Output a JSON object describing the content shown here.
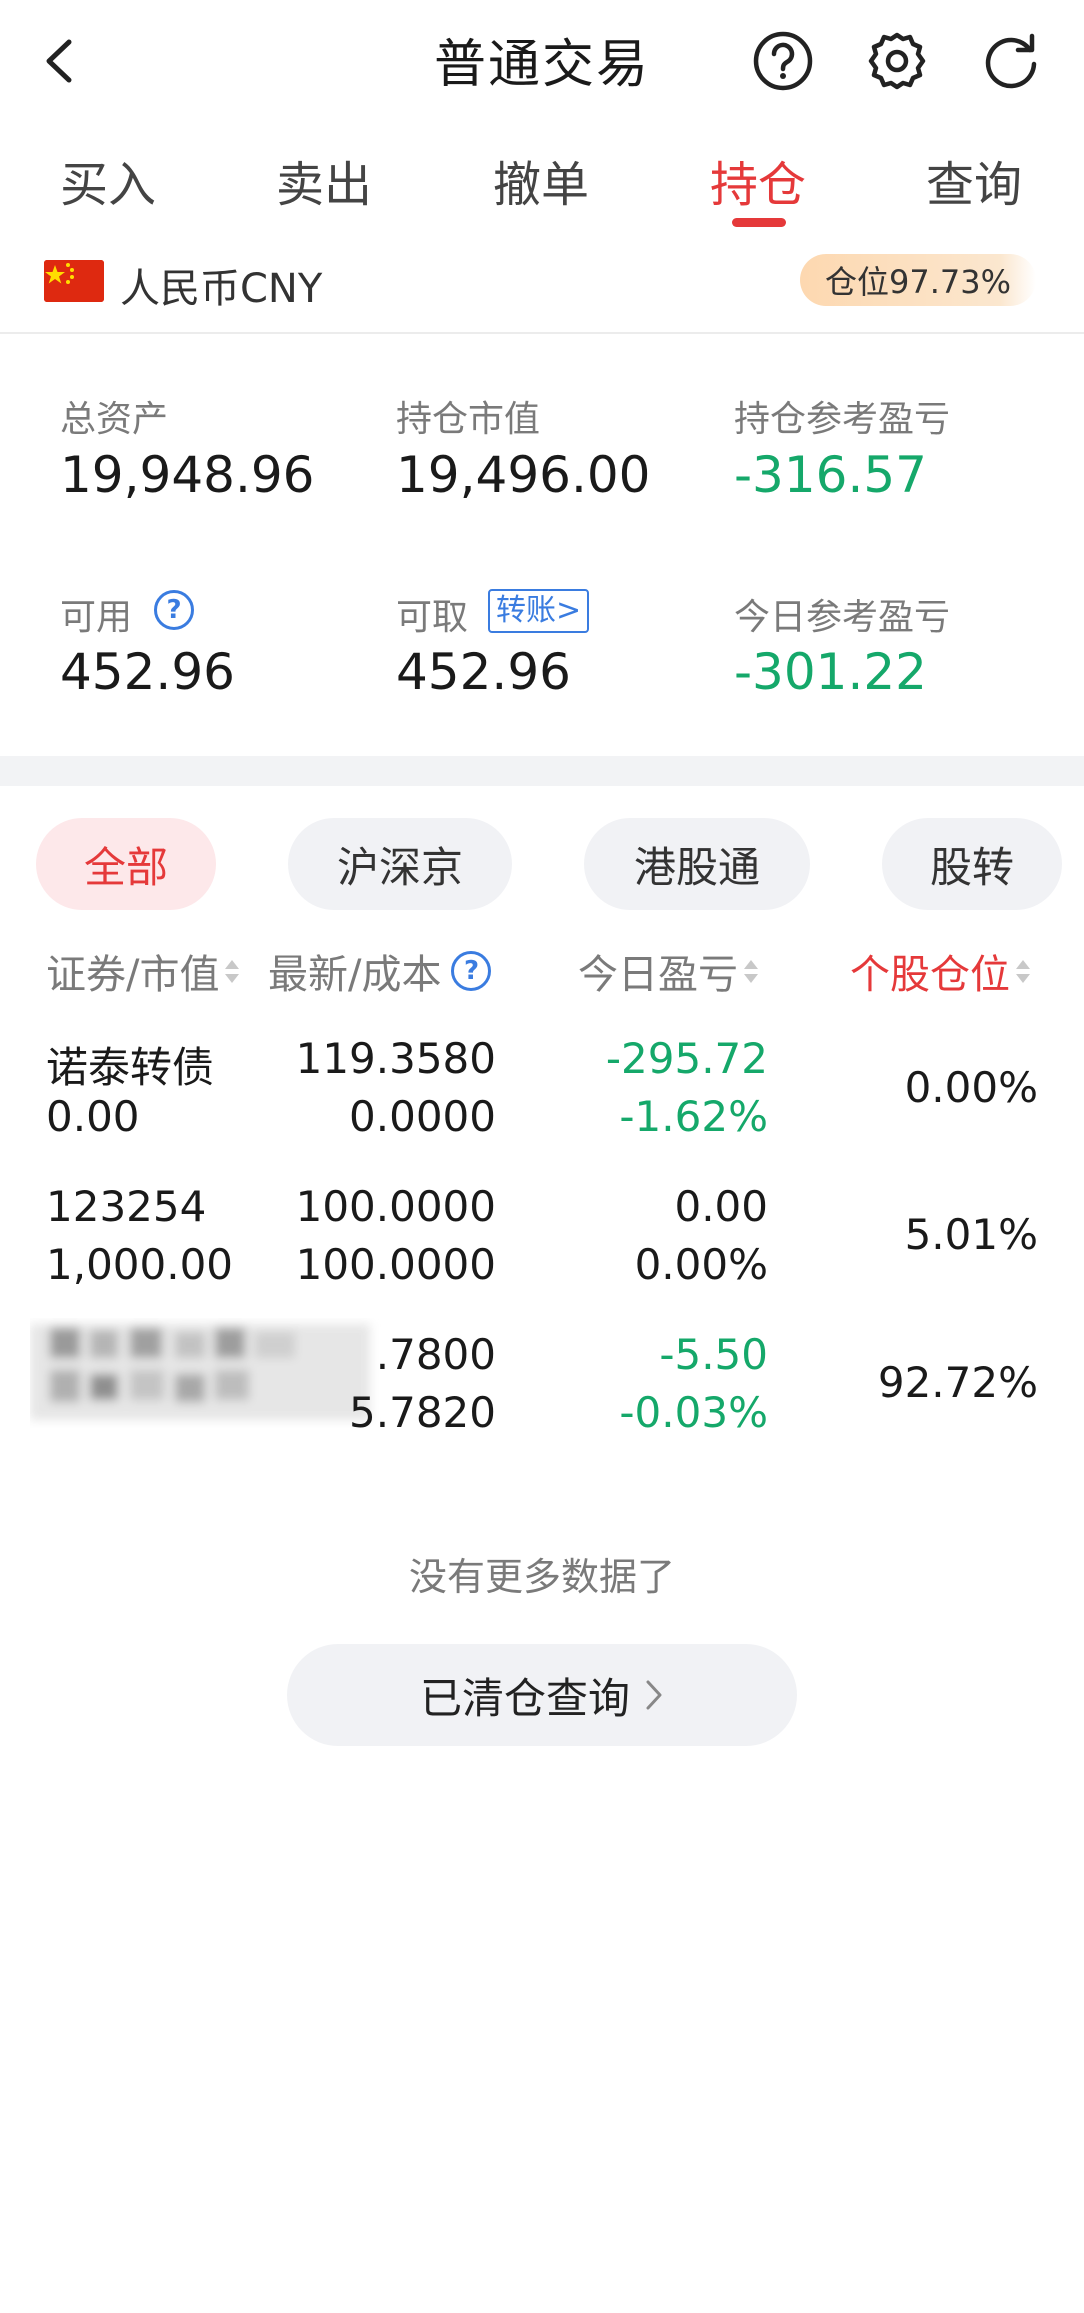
{
  "header": {
    "title": "普通交易"
  },
  "tabs": [
    {
      "label": "买入",
      "active": false
    },
    {
      "label": "卖出",
      "active": false
    },
    {
      "label": "撤单",
      "active": false
    },
    {
      "label": "持仓",
      "active": true
    },
    {
      "label": "查询",
      "active": false
    }
  ],
  "currency": {
    "label": "人民币CNY",
    "position_badge": "仓位97.73%"
  },
  "summary": {
    "total_assets_label": "总资产",
    "total_assets": "19,948.96",
    "market_value_label": "持仓市值",
    "market_value": "19,496.00",
    "ref_pl_label": "持仓参考盈亏",
    "ref_pl": "-316.57",
    "available_label": "可用",
    "available": "452.96",
    "withdrawable_label": "可取",
    "transfer_label": "转账>",
    "withdrawable": "452.96",
    "today_pl_label": "今日参考盈亏",
    "today_pl": "-301.22"
  },
  "filters": [
    {
      "label": "全部",
      "active": true
    },
    {
      "label": "沪深京",
      "active": false
    },
    {
      "label": "港股通",
      "active": false
    },
    {
      "label": "股转",
      "active": false
    }
  ],
  "table": {
    "headers": {
      "security": "证券/市值",
      "price": "最新/成本",
      "today_pl": "今日盈亏",
      "weight": "个股仓位"
    },
    "rows": [
      {
        "name": "诺泰转债",
        "value": "0.00",
        "latest": "119.3580",
        "cost": "0.0000",
        "pl": "-295.72",
        "pl_pct": "-1.62%",
        "weight": "0.00%"
      },
      {
        "name": "123254",
        "value": "1,000.00",
        "latest": "100.0000",
        "cost": "100.0000",
        "pl": "0.00",
        "pl_pct": "0.00%",
        "weight": "5.01%"
      },
      {
        "name": "",
        "value": "",
        "latest": ".7800",
        "cost": "5.7820",
        "pl": "-5.50",
        "pl_pct": "-0.03%",
        "weight": "92.72%"
      }
    ]
  },
  "footer": {
    "no_more": "没有更多数据了",
    "cleared_query": "已清仓查询"
  },
  "colors": {
    "accent_red": "#e5393a",
    "loss_green": "#15a86a",
    "link_blue": "#3a7ce0"
  }
}
